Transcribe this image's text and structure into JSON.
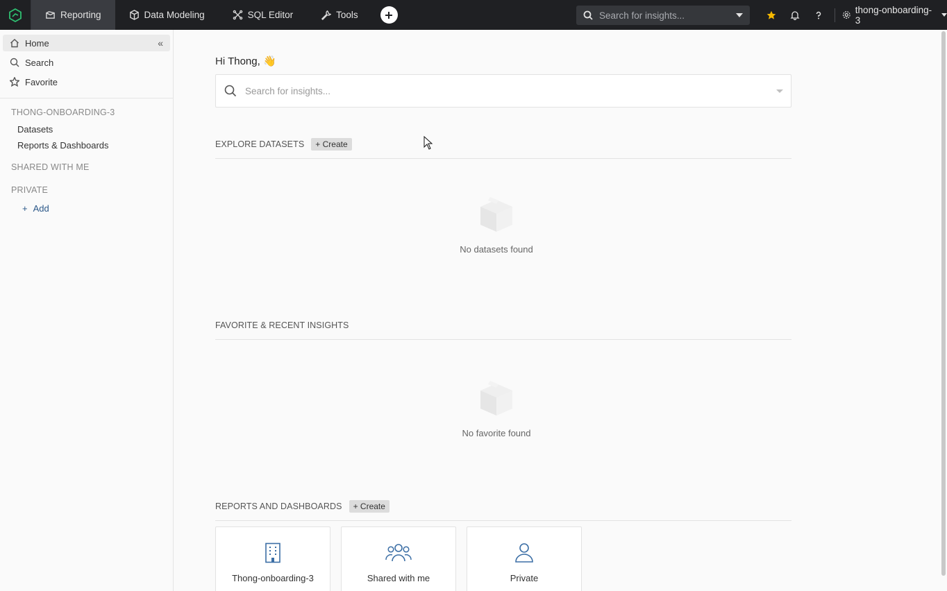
{
  "topbar": {
    "nav": [
      {
        "label": "Reporting",
        "icon": "reporting-icon"
      },
      {
        "label": "Data Modeling",
        "icon": "cube-icon"
      },
      {
        "label": "SQL Editor",
        "icon": "sql-icon"
      },
      {
        "label": "Tools",
        "icon": "wrench-icon"
      }
    ],
    "search_placeholder": "Search for insights...",
    "workspace": "thong-onboarding-3",
    "star_color": "#f5b800"
  },
  "sidebar": {
    "home": "Home",
    "search": "Search",
    "favorite": "Favorite",
    "workspace_heading": "THONG-ONBOARDING-3",
    "datasets": "Datasets",
    "reports": "Reports & Dashboards",
    "shared_heading": "SHARED WITH ME",
    "private_heading": "PRIVATE",
    "add": "Add"
  },
  "main": {
    "greeting_prefix": "Hi",
    "greeting_name": "Thong,",
    "greeting_emoji": "👋",
    "search_placeholder": "Search for insights...",
    "explore": {
      "title": "EXPLORE DATASETS",
      "create": "+ Create",
      "empty": "No datasets found"
    },
    "favorites": {
      "title": "FAVORITE & RECENT INSIGHTS",
      "empty": "No favorite found"
    },
    "reports": {
      "title": "REPORTS AND DASHBOARDS",
      "create": "+ Create",
      "cards": [
        {
          "label": "Thong-onboarding-3",
          "icon": "building-icon"
        },
        {
          "label": "Shared with me",
          "icon": "users-icon"
        },
        {
          "label": "Private",
          "icon": "user-icon"
        }
      ]
    }
  },
  "colors": {
    "accent_blue": "#3b6ea5",
    "topbar_bg": "#1f2023"
  }
}
